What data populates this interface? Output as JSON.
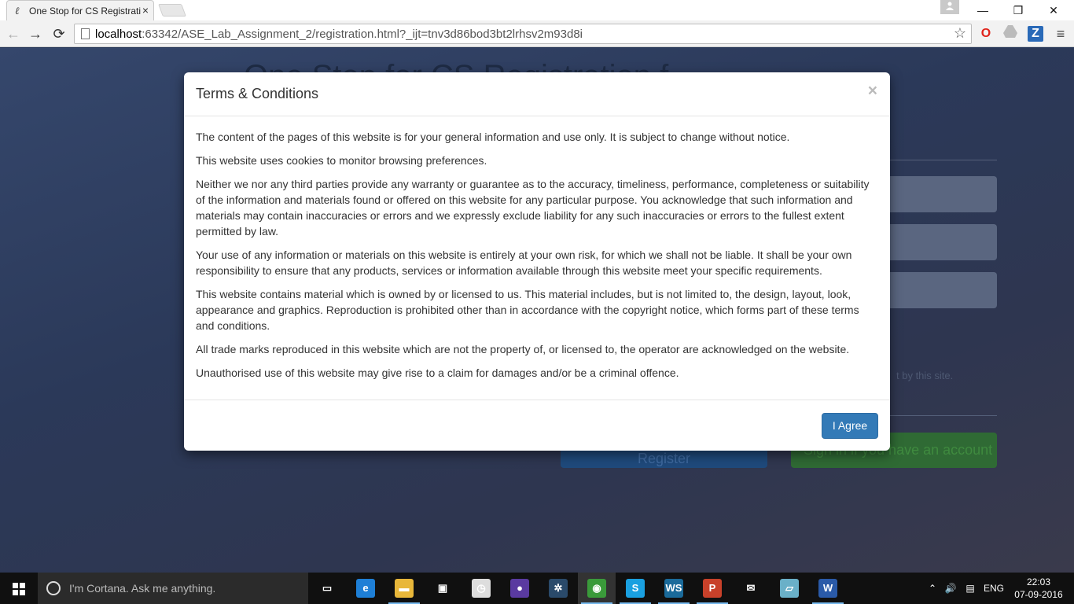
{
  "browser": {
    "tab_title": "One Stop for CS Registrati",
    "tab_close": "×",
    "url_host": "localhost",
    "url_rest": ":63342/ASE_Lab_Assignment_2/registration.html?_ijt=tnv3d86bod3bt2lrhsv2m93d8i",
    "window_controls": {
      "minimize": "—",
      "restore": "❐",
      "close": "✕"
    },
    "nav": {
      "back": "←",
      "forward": "→",
      "reload": "⟳"
    },
    "star": "☆",
    "ext_opera": "O",
    "ext_z": "Z",
    "menu": "≡"
  },
  "page": {
    "bg_title": "One Stop for CS Registration f",
    "bg_note": "t by this site.",
    "register_label": "Register",
    "signin_label": "Sign in if you have an account"
  },
  "modal": {
    "title": "Terms & Conditions",
    "close": "×",
    "paragraphs": [
      "The content of the pages of this website is for your general information and use only. It is subject to change without notice.",
      "This website uses cookies to monitor browsing preferences.",
      "Neither we nor any third parties provide any warranty or guarantee as to the accuracy, timeliness, performance, completeness or suitability of the information and materials found or offered on this website for any particular purpose. You acknowledge that such information and materials may contain inaccuracies or errors and we expressly exclude liability for any such inaccuracies or errors to the fullest extent permitted by law.",
      "Your use of any information or materials on this website is entirely at your own risk, for which we shall not be liable. It shall be your own responsibility to ensure that any products, services or information available through this website meet your specific requirements.",
      "This website contains material which is owned by or licensed to us. This material includes, but is not limited to, the design, layout, look, appearance and graphics. Reproduction is prohibited other than in accordance with the copyright notice, which forms part of these terms and conditions.",
      "All trade marks reproduced in this website which are not the property of, or licensed to, the operator are acknowledged on the website.",
      "Unauthorised use of this website may give rise to a claim for damages and/or be a criminal offence."
    ],
    "agree_label": "I Agree",
    "accent": "#337ab7"
  },
  "taskbar": {
    "cortana_text": "I'm Cortana. Ask me anything.",
    "tray_lang": "ENG",
    "tray_chevron": "⌃",
    "tray_volume": "🔊",
    "tray_notify": "▤",
    "time": "22:03",
    "date": "07-09-2016",
    "apps": [
      {
        "name": "task-view-icon",
        "glyph": "▭",
        "color": "#101010"
      },
      {
        "name": "edge-icon",
        "glyph": "e",
        "color": "#1e7fd6"
      },
      {
        "name": "file-explorer-icon",
        "glyph": "▬",
        "color": "#e8b73a"
      },
      {
        "name": "store-icon",
        "glyph": "▣",
        "color": "#101010"
      },
      {
        "name": "app-clock-icon",
        "glyph": "◷",
        "color": "#ddd"
      },
      {
        "name": "app-purple-icon",
        "glyph": "●",
        "color": "#5a3aa0"
      },
      {
        "name": "app-tree-icon",
        "glyph": "✲",
        "color": "#2a4a6a"
      },
      {
        "name": "chrome-icon",
        "glyph": "◉",
        "color": "#3a9a3a"
      },
      {
        "name": "skype-icon",
        "glyph": "S",
        "color": "#1aa0e0"
      },
      {
        "name": "webstorm-icon",
        "glyph": "WS",
        "color": "#1a6a9a"
      },
      {
        "name": "powerpoint-icon",
        "glyph": "P",
        "color": "#c8412a"
      },
      {
        "name": "mail-icon",
        "glyph": "✉",
        "color": "#101010"
      },
      {
        "name": "app-doc-icon",
        "glyph": "▱",
        "color": "#6ab0c8"
      },
      {
        "name": "word-icon",
        "glyph": "W",
        "color": "#2a5aa8"
      }
    ]
  }
}
